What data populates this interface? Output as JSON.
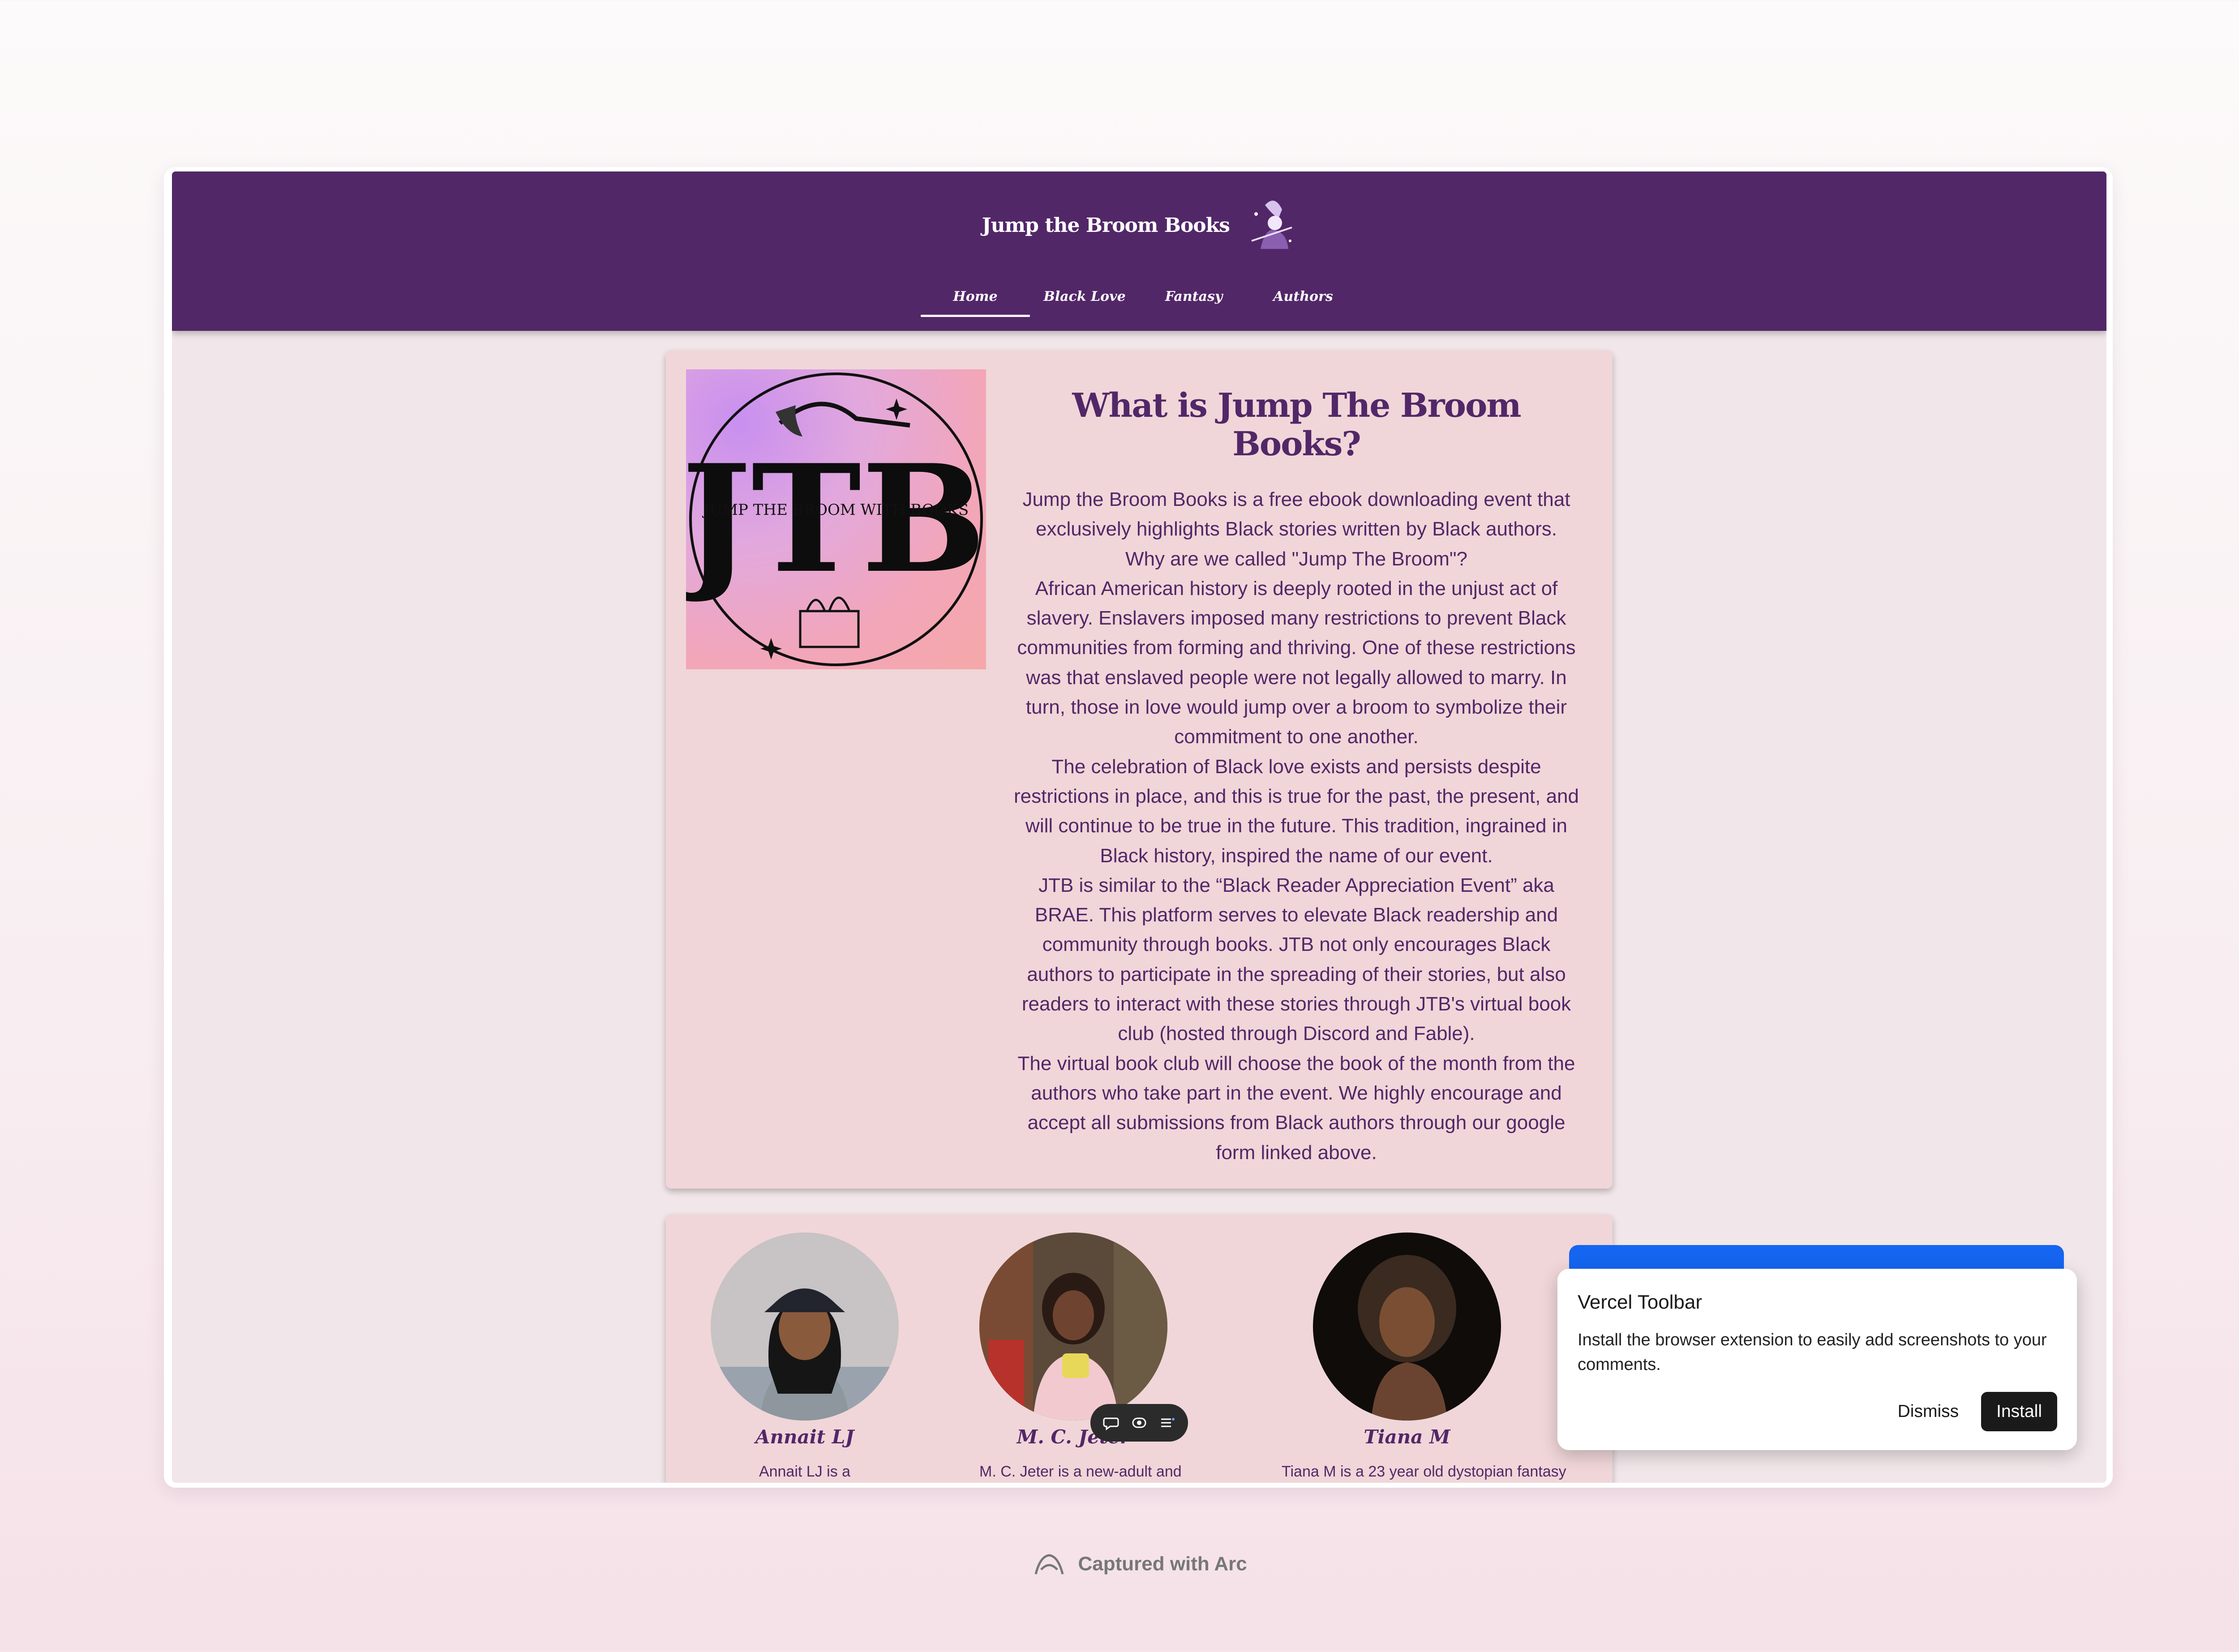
{
  "site": {
    "brand_title": "Jump the Broom Books",
    "nav": [
      {
        "label": "Home",
        "active": true
      },
      {
        "label": "Black Love",
        "active": false
      },
      {
        "label": "Fantasy",
        "active": false
      },
      {
        "label": "Authors",
        "active": false
      }
    ]
  },
  "about": {
    "logo_lettering": "JTB",
    "logo_ring_text": "JUMP THE BROOM WITH BOOKS",
    "heading": "What is Jump The Broom Books?",
    "lines": [
      "Jump the Broom Books is a free ebook downloading event that",
      "exclusively highlights Black stories written by Black authors.",
      "Why are we called \"Jump The Broom\"?",
      "African American history is deeply rooted in the unjust act of",
      "slavery. Enslavers imposed many restrictions to prevent Black",
      "communities from forming and thriving. One of these restrictions",
      "was that enslaved people were not legally allowed to marry. In",
      "turn, those in love would jump over a broom to symbolize their",
      "commitment to one another.",
      "The celebration of Black love exists and persists despite",
      "restrictions in place, and this is true for the past, the present, and",
      "will continue to be true in the future. This tradition, ingrained in",
      "Black history, inspired the name of our event.",
      "JTB is similar to the “Black Reader Appreciation Event” aka",
      "BRAE. This platform serves to elevate Black readership and",
      "community through books. JTB not only encourages Black",
      "authors to participate in the spreading of their stories, but also",
      "readers to interact with these stories through JTB's virtual book",
      "club (hosted through Discord and Fable).",
      "The virtual book club will choose the book of the month from the",
      "authors who take part in the event. We highly encourage and",
      "accept all submissions from Black authors through our google",
      "form linked above."
    ]
  },
  "authors": [
    {
      "name": "Annait LJ",
      "bio": "Annait LJ is a"
    },
    {
      "name": "M. C. Jeter",
      "bio": "M. C. Jeter is a new-adult and"
    },
    {
      "name": "Tiana M",
      "bio": "Tiana M is a 23 year old dystopian fantasy"
    }
  ],
  "vercel_popup": {
    "title": "Vercel Toolbar",
    "message": "Install the browser extension to easily add screenshots to your comments.",
    "dismiss_label": "Dismiss",
    "install_label": "Install"
  },
  "footer": {
    "capture_label": "Captured with Arc"
  },
  "colors": {
    "nav_purple": "#522768",
    "card_pink": "#f0d6d8",
    "page_bg": "#f1e6e9",
    "vercel_blue": "#1565f0"
  }
}
